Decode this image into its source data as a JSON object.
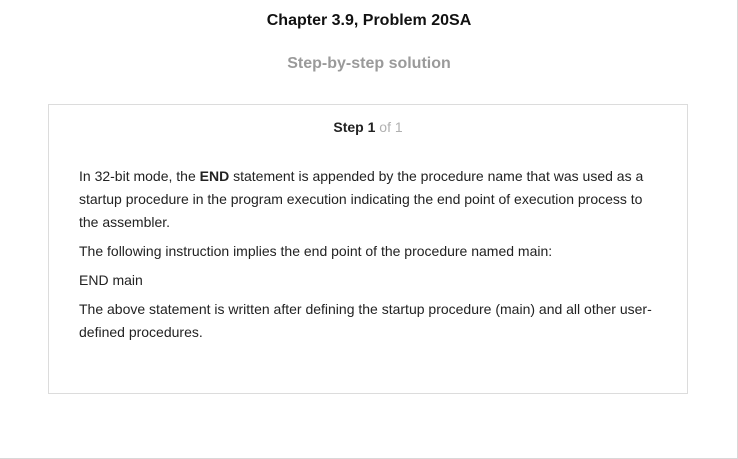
{
  "page": {
    "title": "Chapter 3.9, Problem 20SA",
    "subtitle": "Step-by-step solution"
  },
  "step": {
    "label": "Step",
    "number": "1",
    "of_text": "of 1",
    "paragraphs": [
      {
        "before": "In 32-bit mode, the ",
        "bold": "END",
        "after": " statement is appended by the procedure name that was used as a startup procedure in the program execution indicating the end point of execution process to the assembler."
      },
      {
        "text": "The following instruction implies the end point of the procedure named main:"
      },
      {
        "text": "END main"
      },
      {
        "text": "The above statement is written after defining the startup procedure (main) and all other user-defined procedures."
      }
    ]
  }
}
